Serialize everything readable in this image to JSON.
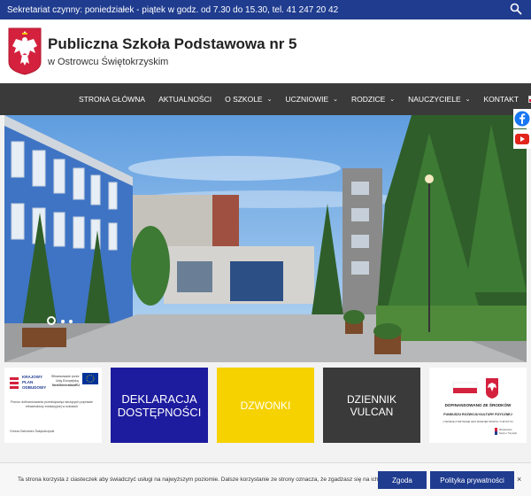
{
  "topbar": {
    "info": "Sekretariat czynny: poniedziałek - piątek w godz. od 7.30 do 15.30, tel. 41 247 20 42"
  },
  "header": {
    "title": "Publiczna Szkoła Podstawowa nr 5",
    "subtitle": "w Ostrowcu Świętokrzyskim"
  },
  "nav": {
    "items": [
      {
        "label": "STRONA GŁÓWNA",
        "dropdown": false
      },
      {
        "label": "AKTUALNOŚCI",
        "dropdown": false
      },
      {
        "label": "O SZKOLE",
        "dropdown": true
      },
      {
        "label": "UCZNIOWIE",
        "dropdown": true
      },
      {
        "label": "RODZICE",
        "dropdown": true
      },
      {
        "label": "NAUCZYCIELE",
        "dropdown": true
      },
      {
        "label": "KONTAKT",
        "dropdown": false
      }
    ],
    "chevron": "⌄"
  },
  "tiles": {
    "eu": {
      "l1": "KRAJOWY",
      "l2": "PLAN",
      "l3": "ODBUDOWY",
      "eu1": "Sfinansowane przez",
      "eu2": "Unię Europejską",
      "eu3": "NextGenerationEU",
      "body": "Pomoc dofinansowania przedsięwzięć służących poprawie infrastruktury edukacyjnej w szkołach",
      "foot": "Gmina Ostrowiec Świętokrzyski"
    },
    "deklaracja": {
      "l1": "DEKLARACJA",
      "l2": "DOSTĘPNOŚCI"
    },
    "dzwonki": "DZWONKI",
    "dziennik": {
      "l1": "DZIENNIK",
      "l2": "VULCAN"
    },
    "dofinansowano": {
      "title": "DOFINANSOWANO ZE ŚRODKÓW",
      "fund": "FUNDUSZU ROZWOJU KULTURY FIZYCZNEJ",
      "small": "UTWORZE OTRZYMANIE JEST MINISTER SPORTU I TURYSTYKI",
      "ministry1": "Ministerstwo",
      "ministry2": "Sportu i Turystyki"
    }
  },
  "cookie": {
    "text": "Ta strona korzysta z ciasteczek aby świadczyć usługi na najwyższym poziomie. Dalsze korzystanie ze strony oznacza, że zgadzasz się na ich użycie.",
    "agree": "Zgoda",
    "policy": "Polityka prywatności",
    "close": "×"
  },
  "colors": {
    "topbar": "#1f3c8f",
    "nav": "#3a3a3a",
    "deklaracja": "#1d1b9e",
    "dzwonki": "#f5d200",
    "dziennik": "#3a3a3a"
  },
  "icons": {
    "search": "search-icon",
    "facebook": "facebook-icon",
    "youtube": "youtube-icon",
    "flag": "poland-flag-icon"
  }
}
